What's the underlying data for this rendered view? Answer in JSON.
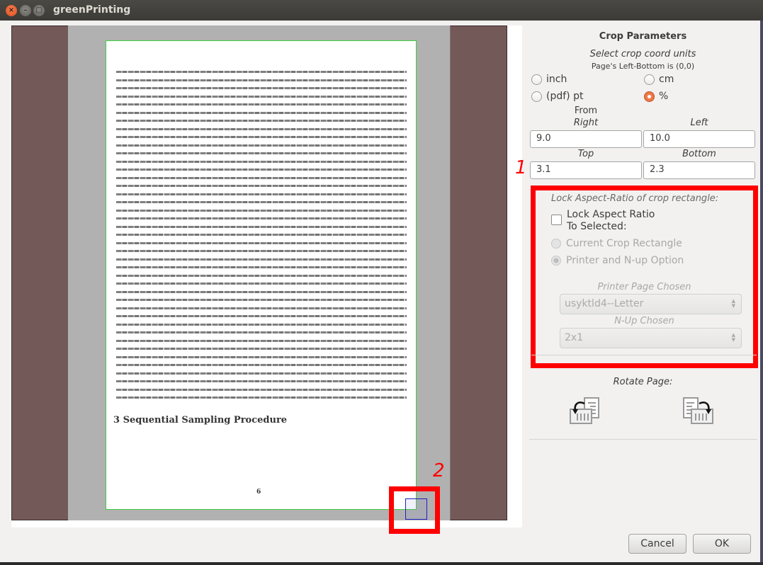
{
  "window": {
    "title": "greenPrinting",
    "controls": [
      "close-icon",
      "minimize-icon",
      "maximize-icon"
    ]
  },
  "preview": {
    "section_heading": "3 Sequential Sampling Procedure",
    "page_number": "6",
    "annotation_2": "2"
  },
  "crop_parameters": {
    "title": "Crop Parameters",
    "units_prompt": "Select crop coord units",
    "origin_note": "Page's Left-Bottom is (0,0)",
    "units": [
      {
        "label": "inch",
        "selected": false
      },
      {
        "label": "cm",
        "selected": false
      },
      {
        "label": "(pdf) pt",
        "selected": false
      },
      {
        "label": "%",
        "selected": true
      }
    ],
    "from_label": "From",
    "fields": {
      "right": {
        "label": "Right",
        "value": "9.0"
      },
      "left": {
        "label": "Left",
        "value": "10.0"
      },
      "top": {
        "label": "Top",
        "value": "3.1"
      },
      "bottom": {
        "label": "Bottom",
        "value": "2.3"
      }
    },
    "annotation_1": "1"
  },
  "lock_aspect": {
    "title": "Lock Aspect-Ratio of crop rectangle:",
    "checkbox_line1": "Lock Aspect Ratio",
    "checkbox_line2": "To Selected:",
    "checked": false,
    "options": [
      {
        "label": "Current Crop Rectangle",
        "selected": false
      },
      {
        "label": "Printer and N-up Option",
        "selected": true
      }
    ],
    "printer_page_label": "Printer Page Chosen",
    "printer_page_value": "usyktld4--Letter",
    "nup_label": "N-Up Chosen",
    "nup_value": "2x1"
  },
  "rotate": {
    "label": "Rotate Page:",
    "ccw_icon": "rotate-ccw-icon",
    "cw_icon": "rotate-cw-icon"
  },
  "footer": {
    "cancel": "Cancel",
    "ok": "OK"
  },
  "colors": {
    "annotation_red": "#ff0000",
    "page_border_green": "#3fcf3f",
    "crop_handle_blue": "#2020c0",
    "margin_brown": "#745959",
    "radio_accent": "#f07746"
  }
}
